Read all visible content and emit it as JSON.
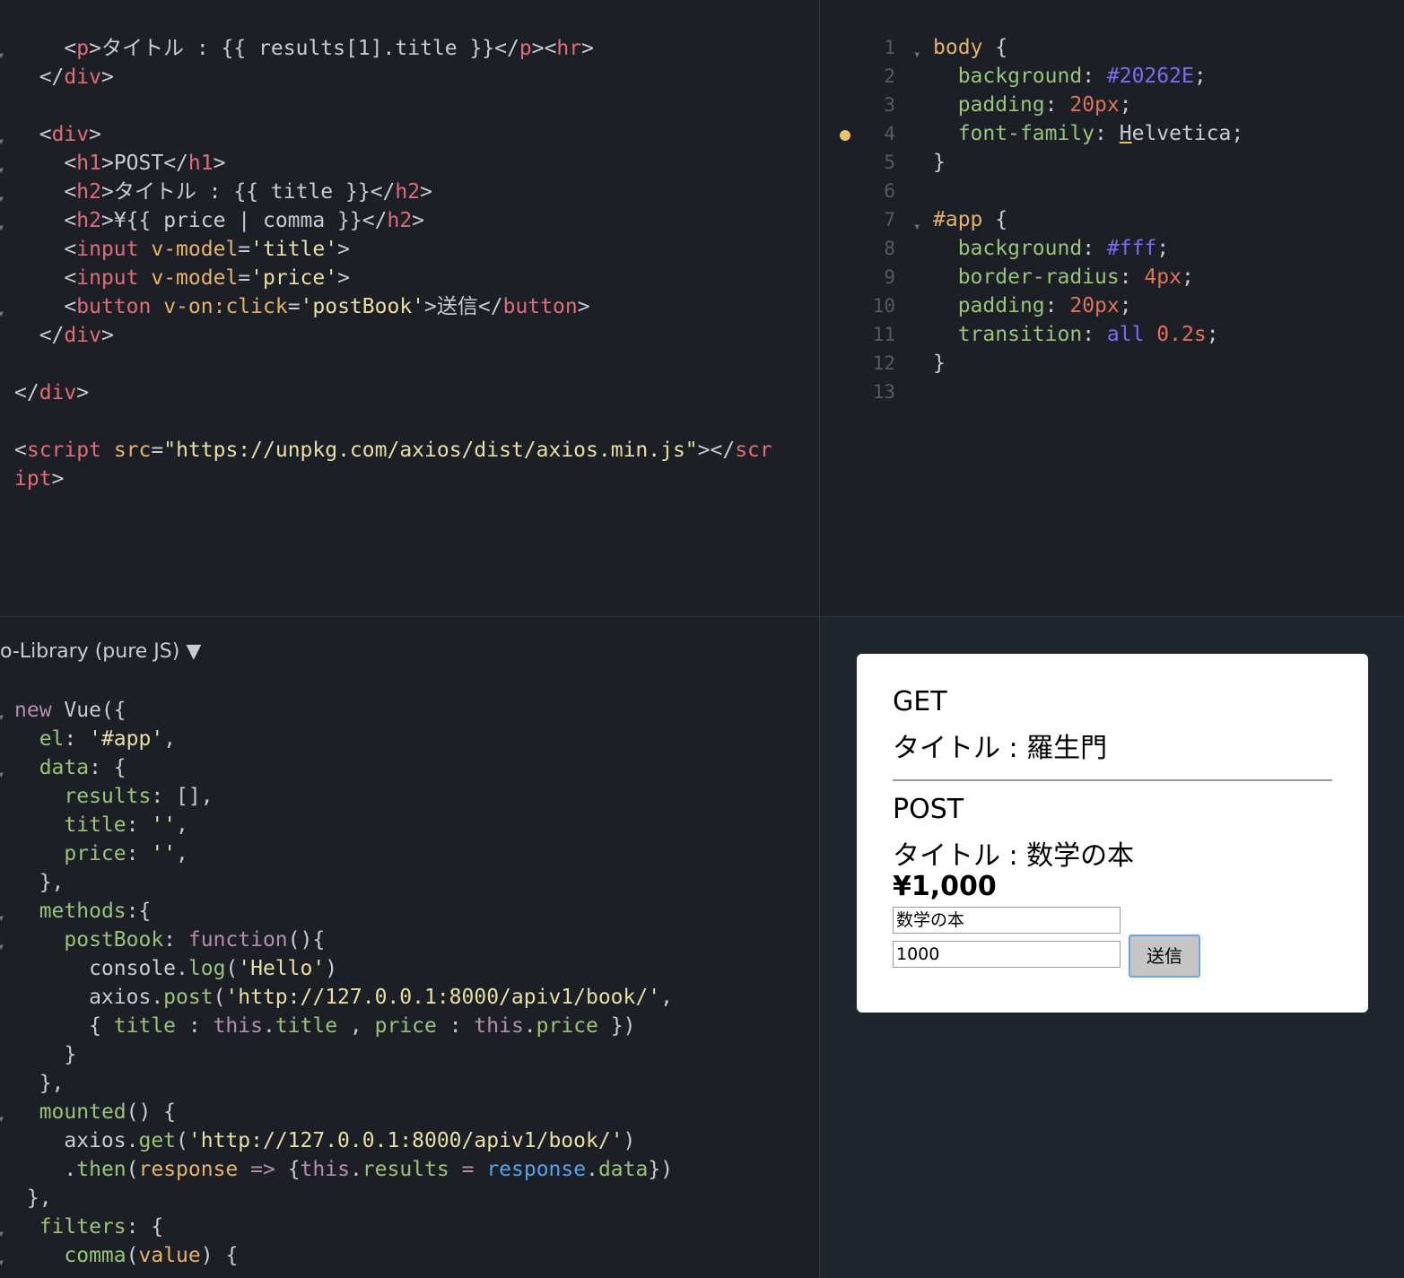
{
  "html_pane": {
    "lines": [
      {
        "fold": true,
        "html": "    <span class='punc'>&lt;</span><span class='tag'>p</span><span class='punc'>&gt;</span>タイトル : {{ results[1].title }}<span class='punc'>&lt;/</span><span class='tag'>p</span><span class='punc'>&gt;&lt;</span><span class='tag'>hr</span><span class='punc'>&gt;</span>"
      },
      {
        "fold": false,
        "html": "  <span class='punc'>&lt;/</span><span class='tag'>div</span><span class='punc'>&gt;</span>"
      },
      {
        "fold": false,
        "html": ""
      },
      {
        "fold": true,
        "html": "  <span class='punc'>&lt;</span><span class='tag'>div</span><span class='punc'>&gt;</span>"
      },
      {
        "fold": true,
        "html": "    <span class='punc'>&lt;</span><span class='tag'>h1</span><span class='punc'>&gt;</span>POST<span class='punc'>&lt;/</span><span class='tag'>h1</span><span class='punc'>&gt;</span>"
      },
      {
        "fold": true,
        "html": "    <span class='punc'>&lt;</span><span class='tag'>h2</span><span class='punc'>&gt;</span>タイトル : {{ title }}<span class='punc'>&lt;/</span><span class='tag'>h2</span><span class='punc'>&gt;</span>"
      },
      {
        "fold": true,
        "html": "    <span class='punc'>&lt;</span><span class='tag'>h2</span><span class='punc'>&gt;</span>¥{{ price | comma }}<span class='punc'>&lt;/</span><span class='tag'>h2</span><span class='punc'>&gt;</span>"
      },
      {
        "fold": false,
        "html": "    <span class='punc'>&lt;</span><span class='tag'>input</span> <span class='attr'>v-model</span>=<span class='str'>'title'</span><span class='punc'>&gt;</span>"
      },
      {
        "fold": false,
        "html": "    <span class='punc'>&lt;</span><span class='tag'>input</span> <span class='attr'>v-model</span>=<span class='str'>'price'</span><span class='punc'>&gt;</span>"
      },
      {
        "fold": true,
        "html": "    <span class='punc'>&lt;</span><span class='tag'>button</span> <span class='attr'>v-on:click</span>=<span class='str'>'postBook'</span><span class='punc'>&gt;</span>送信<span class='punc'>&lt;/</span><span class='tag'>button</span><span class='punc'>&gt;</span>"
      },
      {
        "fold": false,
        "html": "  <span class='punc'>&lt;/</span><span class='tag'>div</span><span class='punc'>&gt;</span>"
      },
      {
        "fold": false,
        "html": ""
      },
      {
        "fold": false,
        "html": "<span class='punc'>&lt;/</span><span class='tag'>div</span><span class='punc'>&gt;</span>"
      },
      {
        "fold": false,
        "html": ""
      },
      {
        "fold": false,
        "html": "<span class='punc'>&lt;</span><span class='tag'>script</span> <span class='attr'>src</span>=<span class='str'>\"https://unpkg.com/axios/dist/axios.min.js\"</span><span class='punc'>&gt;&lt;/</span><span class='tag'>scr</span>"
      },
      {
        "fold": false,
        "html": "<span class='tag'>ipt</span><span class='punc'>&gt;</span>"
      }
    ]
  },
  "css_pane": {
    "lines": [
      {
        "num": "1",
        "fold": true,
        "html": "<span class='sel'>body</span> {"
      },
      {
        "num": "2",
        "fold": false,
        "html": "  <span class='prop'>background</span>: <span class='var' style='color:#7b6cf0'>#20262E</span>;"
      },
      {
        "num": "3",
        "fold": false,
        "html": "  <span class='prop'>padding</span>: <span class='num'>20px</span>;"
      },
      {
        "num": "4",
        "fold": false,
        "html": "  <span class='prop'>font-family</span>: <span style='text-decoration:underline;text-decoration-color:#e8c26b'>H</span>elvetica;"
      },
      {
        "num": "5",
        "fold": false,
        "html": "}"
      },
      {
        "num": "6",
        "fold": false,
        "html": ""
      },
      {
        "num": "7",
        "fold": true,
        "html": "<span class='sel'>#app</span> {"
      },
      {
        "num": "8",
        "fold": false,
        "html": "  <span class='prop'>background</span>: <span class='var' style='color:#7b6cf0'>#fff</span>;"
      },
      {
        "num": "9",
        "fold": false,
        "html": "  <span class='prop'>border-radius</span>: <span class='num'>4px</span>;"
      },
      {
        "num": "10",
        "fold": false,
        "html": "  <span class='prop'>padding</span>: <span class='num'>20px</span>;"
      },
      {
        "num": "11",
        "fold": false,
        "html": "  <span class='prop'>transition</span>: <span class='var' style='color:#7b6cf0'>all</span> <span class='num'>0.2s</span>;"
      },
      {
        "num": "12",
        "fold": false,
        "html": "}"
      },
      {
        "num": "13",
        "fold": false,
        "html": ""
      }
    ]
  },
  "js_pane": {
    "library_label": "o-Library (pure JS) ▼",
    "lines": [
      {
        "fold": true,
        "html": "<span class='kw'>new</span> Vue({"
      },
      {
        "fold": false,
        "html": "  <span class='prop'>el</span>: <span class='str'>'#app'</span>,"
      },
      {
        "fold": true,
        "html": "  <span class='prop'>data</span>: {"
      },
      {
        "fold": false,
        "html": "    <span class='prop'>results</span>: [],"
      },
      {
        "fold": false,
        "html": "    <span class='prop'>title</span>: <span class='str'>''</span>,"
      },
      {
        "fold": false,
        "html": "    <span class='prop'>price</span>: <span class='str'>''</span>,"
      },
      {
        "fold": false,
        "html": "  },"
      },
      {
        "fold": true,
        "html": "  <span class='prop'>methods</span>:{"
      },
      {
        "fold": true,
        "html": "    <span class='prop'>postBook</span>: <span class='fn'>function</span>(){"
      },
      {
        "fold": false,
        "html": "      console.<span class='prop'>log</span>(<span class='str'>'Hello'</span>)"
      },
      {
        "fold": false,
        "html": "      axios.<span class='prop'>post</span>(<span class='str'>'http://127.0.0.1:8000/apiv1/book/'</span>,"
      },
      {
        "fold": false,
        "html": "      { <span class='prop'>title</span> : <span class='kw'>this</span>.<span class='prop'>title</span> , <span class='prop'>price</span> : <span class='kw'>this</span>.<span class='prop'>price</span> })"
      },
      {
        "fold": false,
        "html": "    }"
      },
      {
        "fold": false,
        "html": "  },"
      },
      {
        "fold": true,
        "html": "  <span class='prop'>mounted</span>() {"
      },
      {
        "fold": false,
        "html": "    axios.<span class='prop'>get</span>(<span class='str'>'http://127.0.0.1:8000/apiv1/book/'</span>)"
      },
      {
        "fold": false,
        "html": "    .<span class='prop'>then</span>(<span class='attr'>response</span> <span class='kw'>=&gt;</span> {<span class='kw'>this</span>.<span class='prop'>results</span> <span class='kw'>=</span> <span class='var'>response</span>.<span class='prop'>data</span>})"
      },
      {
        "fold": false,
        "html": " },"
      },
      {
        "fold": true,
        "html": "  <span class='prop'>filters</span>: {"
      },
      {
        "fold": true,
        "html": "    <span class='prop'>comma</span>(<span class='attr'>value</span>) {"
      }
    ]
  },
  "result": {
    "get_heading": "GET",
    "get_title": "タイトル : 羅生門",
    "post_heading": "POST",
    "post_title": "タイトル : 数学の本",
    "post_price": "¥1,000",
    "title_input": "数学の本",
    "price_input": "1000",
    "send_button": "送信"
  }
}
